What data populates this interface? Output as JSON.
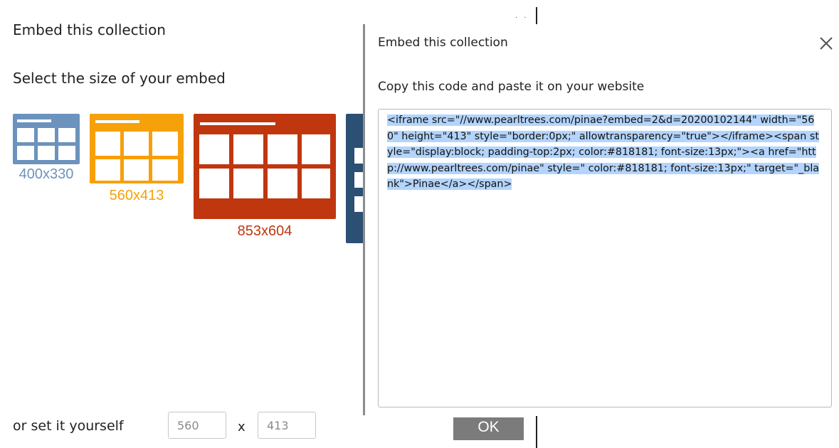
{
  "background_dialog": {
    "title": "Embed this collection",
    "subtitle": "Select the size of your embed",
    "sizes": [
      {
        "label": "400x330",
        "color": "#6b93bd",
        "label_color": "#6b93bd"
      },
      {
        "label": "560x413",
        "color": "#f6a00a",
        "label_color": "#f6a00a"
      },
      {
        "label": "853x604",
        "color": "#c0360e",
        "label_color": "#c0360e"
      },
      {
        "label": "",
        "color": "#2c4f74",
        "label_color": "#2c4f74"
      }
    ],
    "custom_size": {
      "label": "or set it yourself",
      "width_value": "560",
      "height_value": "413",
      "separator": "x"
    },
    "ok_label": "OK",
    "dots": "· ·"
  },
  "modal": {
    "title": "Embed this collection",
    "close_icon": "close-icon",
    "instruction": "Copy this code and paste it on your website",
    "embed_code": "<iframe src=\"//www.pearltrees.com/pinae?embed=2&d=20200102144\" width=\"560\" height=\"413\" style=\"border:0px;\" allowtransparency=\"true\"></iframe><span style=\"display:block; padding-top:2px; color:#818181; font-size:13px;\"><a href=\"http://www.pearltrees.com/pinae\" style=\" color:#818181; font-size:13px;\" target=\"_blank\">Pinae</a></span>",
    "selection_color": "#b3d4fc"
  }
}
